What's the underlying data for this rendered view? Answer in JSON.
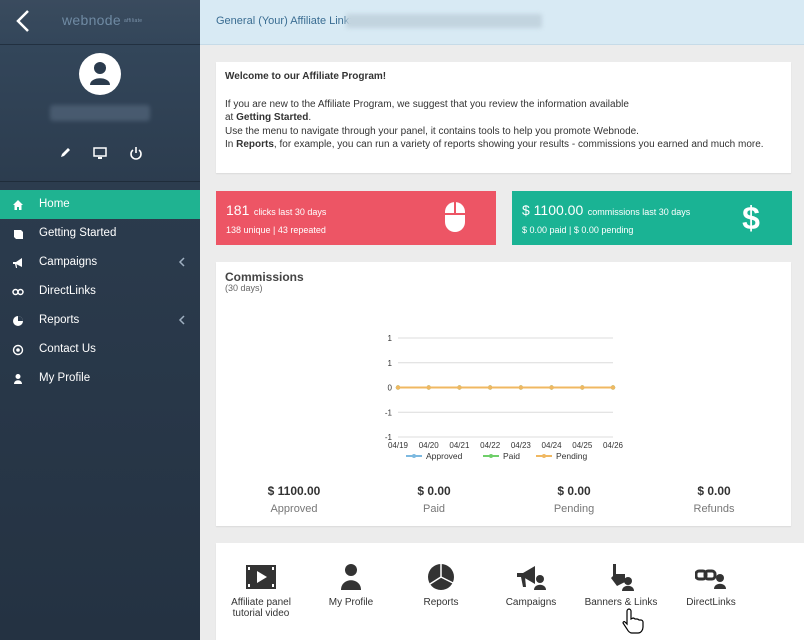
{
  "sidebar": {
    "logo": "webnode",
    "logo_sub": "affiliate",
    "menu": [
      {
        "label": "Home",
        "icon": "home-icon",
        "active": true
      },
      {
        "label": "Getting Started",
        "icon": "book-icon"
      },
      {
        "label": "Campaigns",
        "icon": "bullhorn-icon",
        "submenu": true
      },
      {
        "label": "DirectLinks",
        "icon": "link-icon"
      },
      {
        "label": "Reports",
        "icon": "pie-chart-icon",
        "submenu": true
      },
      {
        "label": "Contact Us",
        "icon": "at-icon"
      },
      {
        "label": "My Profile",
        "icon": "user-icon"
      }
    ]
  },
  "topbar": {
    "label": "General (Your) Affiliate Link:"
  },
  "welcome": {
    "title": "Welcome to our Affiliate Program!",
    "line1": "If you are new to the Affiliate Program, we suggest that you review the information available",
    "line2_pre": "at ",
    "line2_bold": "Getting Started",
    "line2_post": ".",
    "line3": "Use the menu to navigate through your panel, it contains tools to help you promote Webnode.",
    "line4_pre": "In ",
    "line4_bold": "Reports",
    "line4_post": ", for example, you can run a variety of reports showing your results - commissions you earned and much more."
  },
  "stats": {
    "clicks": {
      "value": "181",
      "label": "clicks last 30 days",
      "sub": "138 unique | 43 repeated"
    },
    "commissions": {
      "value": "$ 1100.00",
      "label": "commissions last 30 days",
      "sub": "$ 0.00 paid | $ 0.00 pending"
    }
  },
  "commissions": {
    "title": "Commissions",
    "subtitle": "(30 days)",
    "totals": [
      {
        "amount": "$ 1100.00",
        "label": "Approved"
      },
      {
        "amount": "$ 0.00",
        "label": "Paid"
      },
      {
        "amount": "$ 0.00",
        "label": "Pending"
      },
      {
        "amount": "$ 0.00",
        "label": "Refunds"
      }
    ]
  },
  "chart_data": {
    "type": "line",
    "x": [
      "04/19",
      "04/20",
      "04/21",
      "04/22",
      "04/23",
      "04/24",
      "04/25",
      "04/26"
    ],
    "ylim": [
      -1,
      1
    ],
    "yticks": [
      "1",
      "0",
      "-1"
    ],
    "yminor": [
      "1",
      "1",
      "0",
      "-1",
      "-1"
    ],
    "series": [
      {
        "name": "Approved",
        "color": "#7db9e0",
        "values": [
          0,
          0,
          0,
          0,
          0,
          0,
          0,
          0
        ]
      },
      {
        "name": "Paid",
        "color": "#6fcf6a",
        "values": [
          0,
          0,
          0,
          0,
          0,
          0,
          0,
          0
        ]
      },
      {
        "name": "Pending",
        "color": "#f0b862",
        "values": [
          0,
          0,
          0,
          0,
          0,
          0,
          0,
          0
        ]
      }
    ]
  },
  "shortcuts": [
    {
      "label": "Affiliate panel tutorial video",
      "icon": "video-icon"
    },
    {
      "label": "My Profile",
      "icon": "profile-icon"
    },
    {
      "label": "Reports",
      "icon": "pie-chart-icon"
    },
    {
      "label": "Campaigns",
      "icon": "campaigns-icon"
    },
    {
      "label": "Banners & Links",
      "icon": "banners-icon"
    },
    {
      "label": "DirectLinks",
      "icon": "directlinks-icon"
    }
  ]
}
